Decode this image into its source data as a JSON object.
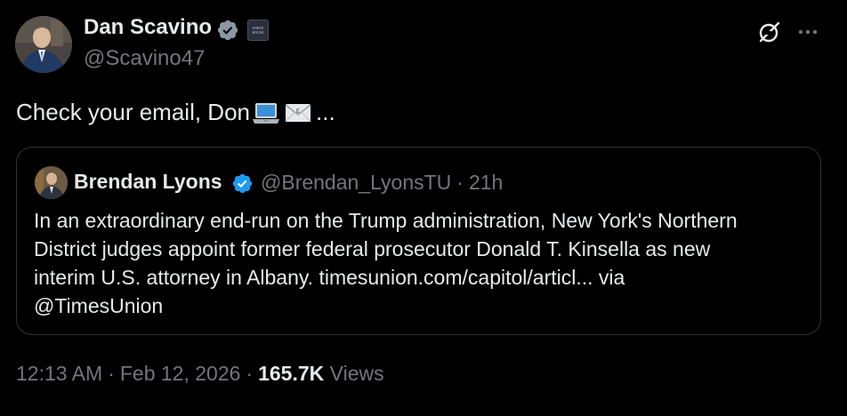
{
  "author": {
    "name": "Dan Scavino",
    "handle": "@Scavino47",
    "affiliation_text": "WHITE HOUSE"
  },
  "tweet": {
    "text": "Check your email, Don",
    "emojis": [
      "laptop-emoji",
      "envelope-emoji"
    ],
    "trailing": "..."
  },
  "quote": {
    "author_name": "Brendan Lyons",
    "author_handle": "@Brendan_LyonsTU",
    "separator": "·",
    "time_ago": "21h",
    "lines": [
      "In an extraordinary end-run on the Trump administration, New York's Northern",
      "District judges appoint former federal prosecutor Donald T. Kinsella as new",
      "interim U.S. attorney in Albany.  timesunion.com/capitol/articl... via",
      "@TimesUnion"
    ]
  },
  "footer": {
    "time": "12:13 AM",
    "separator": "·",
    "date": "Feb 12, 2026",
    "separator2": "·",
    "views_count": "165.7K",
    "views_label": "Views"
  },
  "colors": {
    "background": "#000000",
    "primary_text": "#e7e9ea",
    "secondary_text": "#71767b",
    "verified_blue": "#1d9bf0",
    "border": "#2f3336"
  },
  "icons": {
    "verified": "verified-badge-icon",
    "grok": "grok-icon",
    "more": "more-options-icon"
  }
}
